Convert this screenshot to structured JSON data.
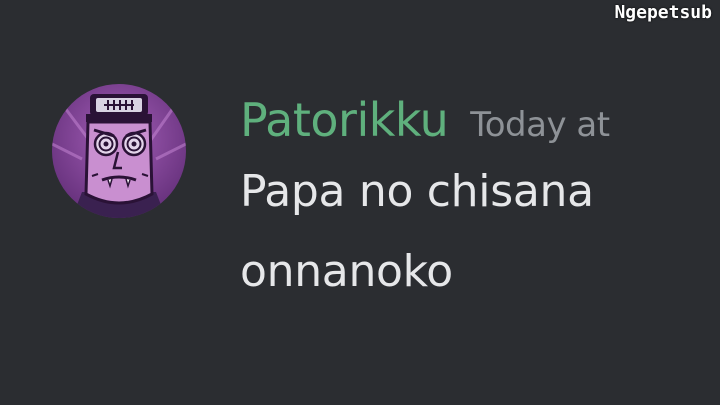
{
  "overlay": {
    "watermark": "Ngepetsub"
  },
  "message": {
    "avatar_icon": "cartoon-character-avatar-icon",
    "username": "Patorikku",
    "timestamp": "Today at",
    "text": "Papa no chisana onnanoko"
  },
  "colors": {
    "background": "#2b2d31",
    "username": "#5fb07d",
    "timestamp": "#8e9297",
    "text": "#e6e7e9",
    "avatar_bg": "#7b3c8e"
  }
}
